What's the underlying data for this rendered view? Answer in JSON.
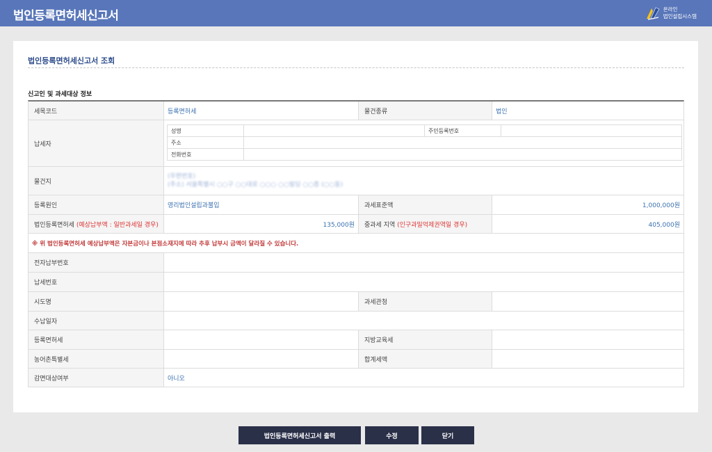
{
  "header": {
    "title": "법인등록면허세신고서",
    "logo_line1": "온라인",
    "logo_line2": "법인설립시스템"
  },
  "page": {
    "heading": "법인등록면허세신고서 조회",
    "section_title": "신고인 및 과세대상 정보"
  },
  "form": {
    "tax_code_label": "세목코드",
    "tax_code_value": "등록면허세",
    "object_type_label": "물건종류",
    "object_type_value": "법인",
    "taxpayer_label": "납세자",
    "taxpayer_name_label": "성명",
    "taxpayer_name_value": "",
    "resident_no_label": "주민등록번호",
    "resident_no_value": "",
    "address_label": "주소",
    "address_value": "",
    "phone_label": "전화번호",
    "phone_value": "",
    "location_label": "물건지",
    "location_line1": "(우편번호)",
    "location_line2": "(주소) 서울특별시 ○○구 ○○대로 ○○○ ○○빌딩 ○○층 (○○동)",
    "reason_label": "등록원인",
    "reason_value": "영리법인설립과불입",
    "tax_base_label": "과세표준액",
    "tax_base_value": "1,000,000원",
    "reg_tax_label": "법인등록면허세",
    "reg_tax_note": "(예상납부액 : 일반과세일 경우)",
    "reg_tax_value": "135,000원",
    "heavy_tax_label": "중과세 지역",
    "heavy_tax_note": "(인구과밀억제권역일 경우)",
    "heavy_tax_value": "405,000원",
    "notice": "※ 위 법인등록면허세 예상납부액은 자본금이나 본점소재지에 따라 추후 납부시 금액이 달라질 수 있습니다.",
    "epay_no_label": "전자납부번호",
    "epay_no_value": "",
    "tax_no_label": "납세번호",
    "tax_no_value": "",
    "city_label": "시도명",
    "city_value": "",
    "tax_office_label": "과세관청",
    "tax_office_value": "",
    "receipt_date_label": "수납일자",
    "receipt_date_value": "",
    "reg_license_tax_label": "등록면허세",
    "reg_license_tax_value": "",
    "local_edu_tax_label": "지방교육세",
    "local_edu_tax_value": "",
    "rural_tax_label": "농어촌특별세",
    "rural_tax_value": "",
    "total_tax_label": "합계세액",
    "total_tax_value": "",
    "exemption_label": "감면대상여부",
    "exemption_value": "아니오"
  },
  "buttons": {
    "print": "법인등록면허세신고서 출력",
    "edit": "수정",
    "close": "닫기"
  },
  "colors": {
    "header_bg": "#5876b9",
    "heading": "#2f4e8c",
    "value": "#3a70b0",
    "warning": "#c23b3b",
    "button_bg": "#2b3049"
  }
}
